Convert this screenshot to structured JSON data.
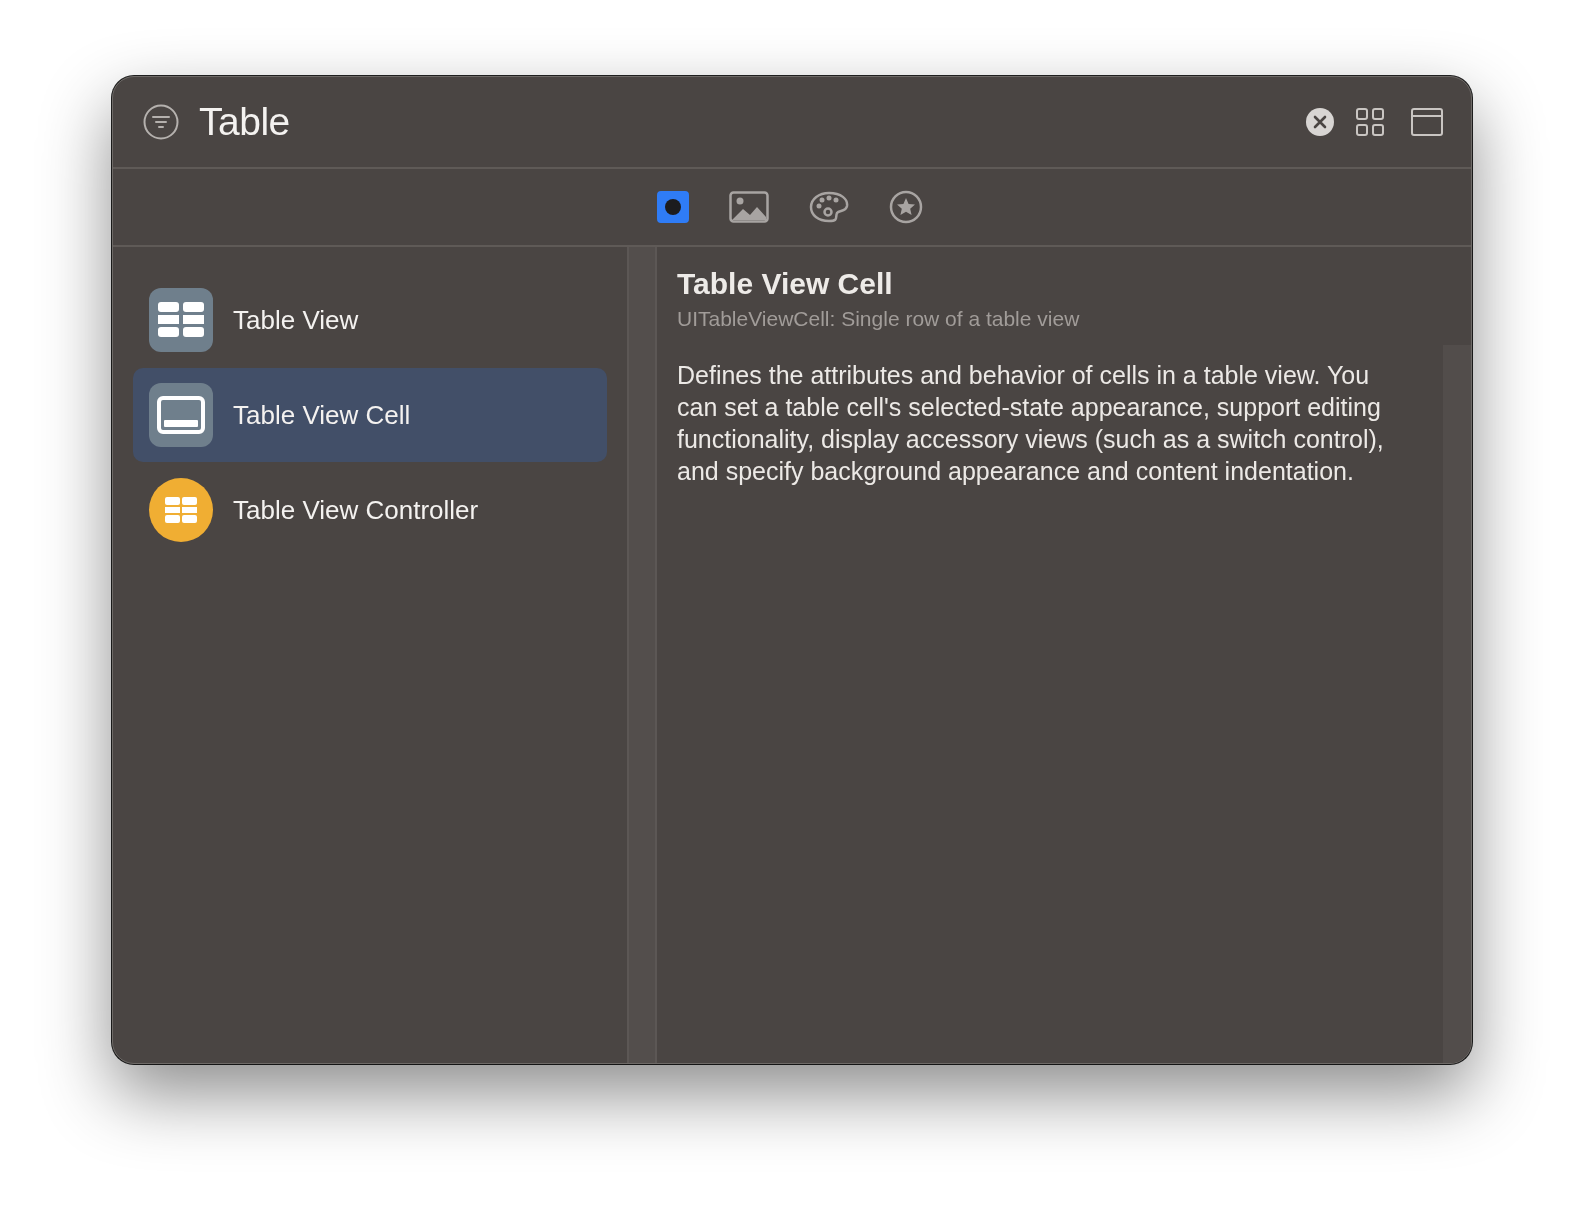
{
  "search": {
    "value": "Table"
  },
  "tabs": [
    {
      "kind": "objects",
      "selected": true
    },
    {
      "kind": "image",
      "selected": false
    },
    {
      "kind": "palette",
      "selected": false
    },
    {
      "kind": "star",
      "selected": false
    }
  ],
  "items": [
    {
      "kind": "table",
      "label": "Table View",
      "selected": false
    },
    {
      "kind": "cell",
      "label": "Table View Cell",
      "selected": true
    },
    {
      "kind": "controller",
      "label": "Table View Controller",
      "selected": false
    }
  ],
  "detail": {
    "title": "Table View Cell",
    "subtitle": "UITableViewCell: Single row of a table view",
    "description": "Defines the attributes and behavior of cells in a table view. You can set a table cell's selected-state appearance, support editing functionality, display accessory views (such as a switch control), and specify background appearance and content indentation."
  }
}
